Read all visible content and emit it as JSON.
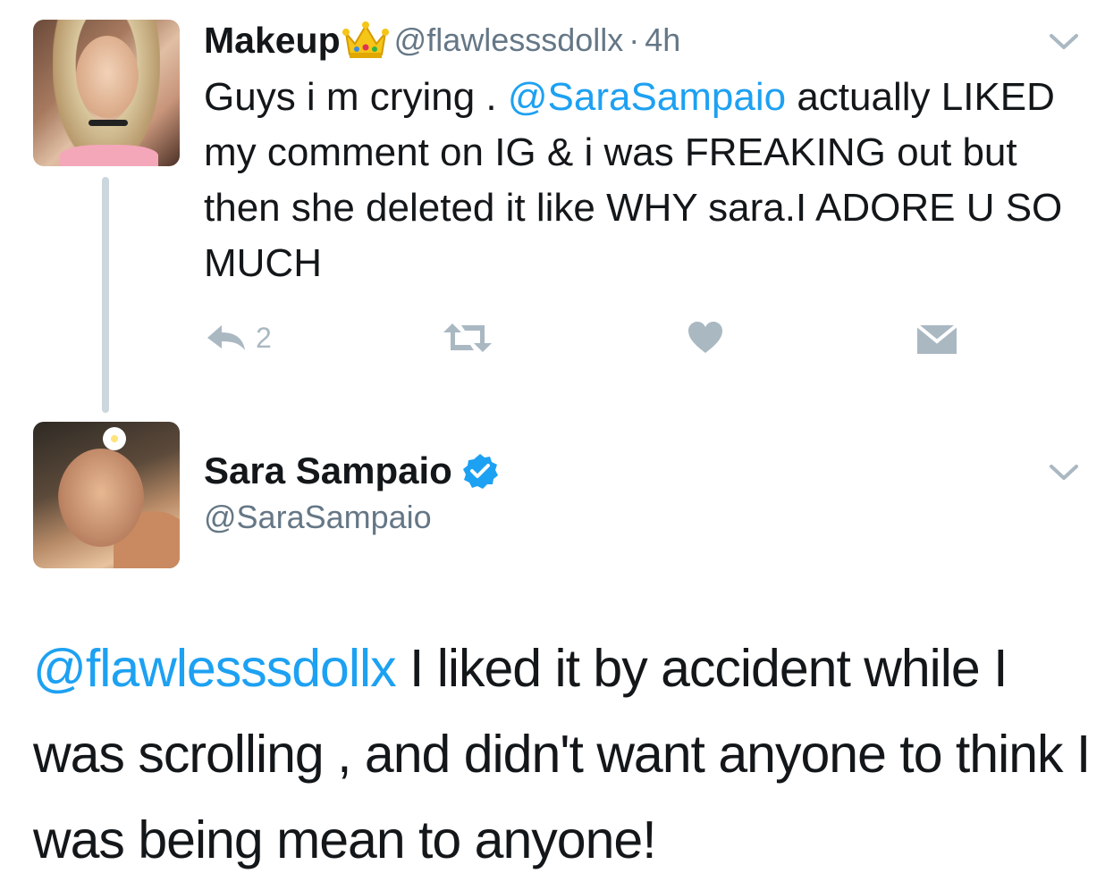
{
  "colors": {
    "link": "#1da1f2",
    "text": "#14171a",
    "muted": "#657786",
    "icon": "#aab8c2",
    "thread_line": "#ccd6dd",
    "verified": "#1da1f2"
  },
  "tweet1": {
    "display_name": "Makeup",
    "name_emoji": "crown-emoji",
    "handle": "@flawlesssdollx",
    "separator": "·",
    "time": "4h",
    "body_before": "Guys i m crying . ",
    "mention": "@SaraSampaio",
    "body_after": " actually LIKED my comment on IG & i was FREAKING out but then she deleted it like WHY sara.I ADORE U SO MUCH",
    "actions": {
      "reply_count": "2",
      "icons": [
        "reply-icon",
        "retweet-icon",
        "heart-icon",
        "dm-icon"
      ]
    }
  },
  "tweet2": {
    "display_name": "Sara Sampaio",
    "verified_icon": "verified-badge-icon",
    "handle": "@SaraSampaio",
    "mention": "@flawlesssdollx",
    "body": " I liked it by accident while I was scrolling , and didn't want anyone to think I was being mean to anyone!"
  }
}
